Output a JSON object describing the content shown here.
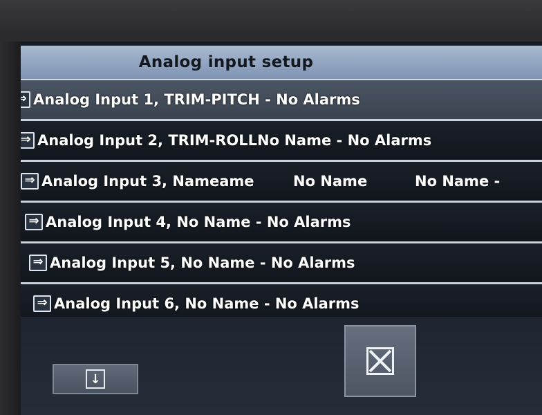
{
  "title": "Analog input setup",
  "rows": [
    {
      "label": "Analog Input 1, TRIM-PITCH - No Alarms",
      "extra1": "",
      "extra2": ""
    },
    {
      "label": "Analog Input 2, TRIM-ROLLNo Name - No Alarms",
      "extra1": "",
      "extra2": ""
    },
    {
      "label": "Analog Input 3, Nameame",
      "extra1": "No Name",
      "extra2": "No Name   -"
    },
    {
      "label": "Analog Input 4, No Name - No Alarms",
      "extra1": "",
      "extra2": ""
    },
    {
      "label": "Analog Input 5, No Name - No Alarms",
      "extra1": "",
      "extra2": ""
    },
    {
      "label": "Analog Input 6, No Name - No Alarms",
      "extra1": "",
      "extra2": ""
    }
  ],
  "icons": {
    "row": "arrow-right-icon",
    "down": "arrow-down-icon",
    "close": "close-icon"
  },
  "glyphs": {
    "row_arrow": "⇒",
    "down_arrow": "↓"
  },
  "colors": {
    "title_bar": "#a9bad0",
    "row_bg": "#11161d",
    "row_highlight": "#4b5563",
    "separator": "#c9d2dc",
    "text": "#ffffff"
  }
}
